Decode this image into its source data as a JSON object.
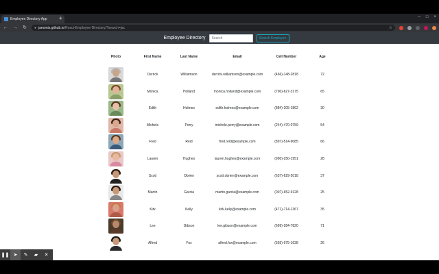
{
  "browser": {
    "tab_title": "Employee Directory App",
    "url_host": "jaeomis.github.io",
    "url_path": "/React-Employee-Directory/?search=jac"
  },
  "header": {
    "title": "Employee Directory",
    "search_placeholder": "Search",
    "search_button": "Search Employee"
  },
  "table": {
    "columns": [
      "Photo",
      "First Name",
      "Last Name",
      "Email",
      "Cell Number",
      "Age"
    ],
    "rows": [
      {
        "first": "Derrick",
        "last": "Williamson",
        "email": "derrick.williamson@example.com",
        "cell": "(466)-148-2818",
        "age": "72",
        "skin": "#c9a58a",
        "hair": "#b8b8b8",
        "shirt": "#777777",
        "bg": "#d8d8d8"
      },
      {
        "first": "Monica",
        "last": "Holland",
        "email": "monica.holland@example.com",
        "cell": "(790)-627-3175",
        "age": "65",
        "skin": "#e0b49a",
        "hair": "#7a4a2a",
        "shirt": "#8aa06a",
        "bg": "#b8c890"
      },
      {
        "first": "Edith",
        "last": "Holmes",
        "email": "edith.holmes@example.com",
        "cell": "(884)-205-1862",
        "age": "30",
        "skin": "#e6c0a8",
        "hair": "#5a3a22",
        "shirt": "#6a8a5a",
        "bg": "#9ab888"
      },
      {
        "first": "Michele",
        "last": "Perry",
        "email": "michele.perry@example.com",
        "cell": "(244)-470-0759",
        "age": "54",
        "skin": "#d9a88e",
        "hair": "#3a2418",
        "shirt": "#c87a6a",
        "bg": "#e0b8a8"
      },
      {
        "first": "Fred",
        "last": "Reid",
        "email": "fred.reid@example.com",
        "cell": "(897)-514-9085",
        "age": "66",
        "skin": "#d8a888",
        "hair": "#5a3a22",
        "shirt": "#3a5a7a",
        "bg": "#8aa8b8"
      },
      {
        "first": "Lauren",
        "last": "Hughes",
        "email": "lauren.hughes@example.com",
        "cell": "(990)-250-1951",
        "age": "28",
        "skin": "#e8b8a0",
        "hair": "#c89870",
        "shirt": "#d88aa0",
        "bg": "#e8c8c8"
      },
      {
        "first": "Scott",
        "last": "Obrien",
        "email": "scott.obrien@example.com",
        "cell": "(637)-629-2018",
        "age": "37",
        "skin": "#c49878",
        "hair": "#2a1a10",
        "shirt": "#222222",
        "bg": "#ffffff"
      },
      {
        "first": "Martin",
        "last": "Garcia",
        "email": "martin.garcia@example.com",
        "cell": "(007)-652-9128",
        "age": "25",
        "skin": "#c89a7a",
        "hair": "#2a1a10",
        "shirt": "#888888",
        "bg": "#e8e8e8"
      },
      {
        "first": "Kirk",
        "last": "Kelly",
        "email": "kirk.kelly@example.com",
        "cell": "(471)-714-1367",
        "age": "35",
        "skin": "#d8a08a",
        "hair": "#c8784a",
        "shirt": "#b05a4a",
        "bg": "#d87a6a"
      },
      {
        "first": "Lee",
        "last": "Gibson",
        "email": "lee.gibson@example.com",
        "cell": "(699)-284-7820",
        "age": "71",
        "skin": "#b8886a",
        "hair": "#6a4a2a",
        "shirt": "#5a3a2a",
        "bg": "#4a3a2a"
      },
      {
        "first": "Alfred",
        "last": "Fox",
        "email": "alfred.fox@example.com",
        "cell": "(555)-975-1638",
        "age": "26",
        "skin": "#c89a7a",
        "hair": "#1a1a1a",
        "shirt": "#2a2a2a",
        "bg": "#ffffff"
      }
    ]
  },
  "recorder": {
    "pause_icon": "pause-icon",
    "cursor_icon": "cursor-icon",
    "pen_icon": "pen-icon",
    "eraser_icon": "eraser-icon",
    "close_icon": "close-icon"
  }
}
